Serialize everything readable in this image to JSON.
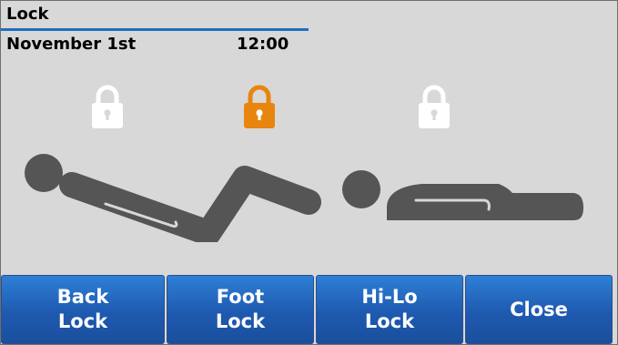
{
  "header": {
    "title": "Lock",
    "date": "November 1st",
    "time": "12:00"
  },
  "locks": [
    {
      "name": "back",
      "state": "unlocked",
      "color": "#ffffff"
    },
    {
      "name": "foot",
      "state": "locked",
      "color": "#e8850f"
    },
    {
      "name": "hilo",
      "state": "unlocked",
      "color": "#ffffff"
    }
  ],
  "buttons": {
    "back_lock": "Back\nLock",
    "foot_lock": "Foot\nLock",
    "hilo_lock": "Hi-Lo\nLock",
    "close": "Close"
  },
  "colors": {
    "accent": "#1f6fbf",
    "button": "#1e5ab0",
    "figure": "#555555",
    "panel": "#d9d8d8"
  }
}
